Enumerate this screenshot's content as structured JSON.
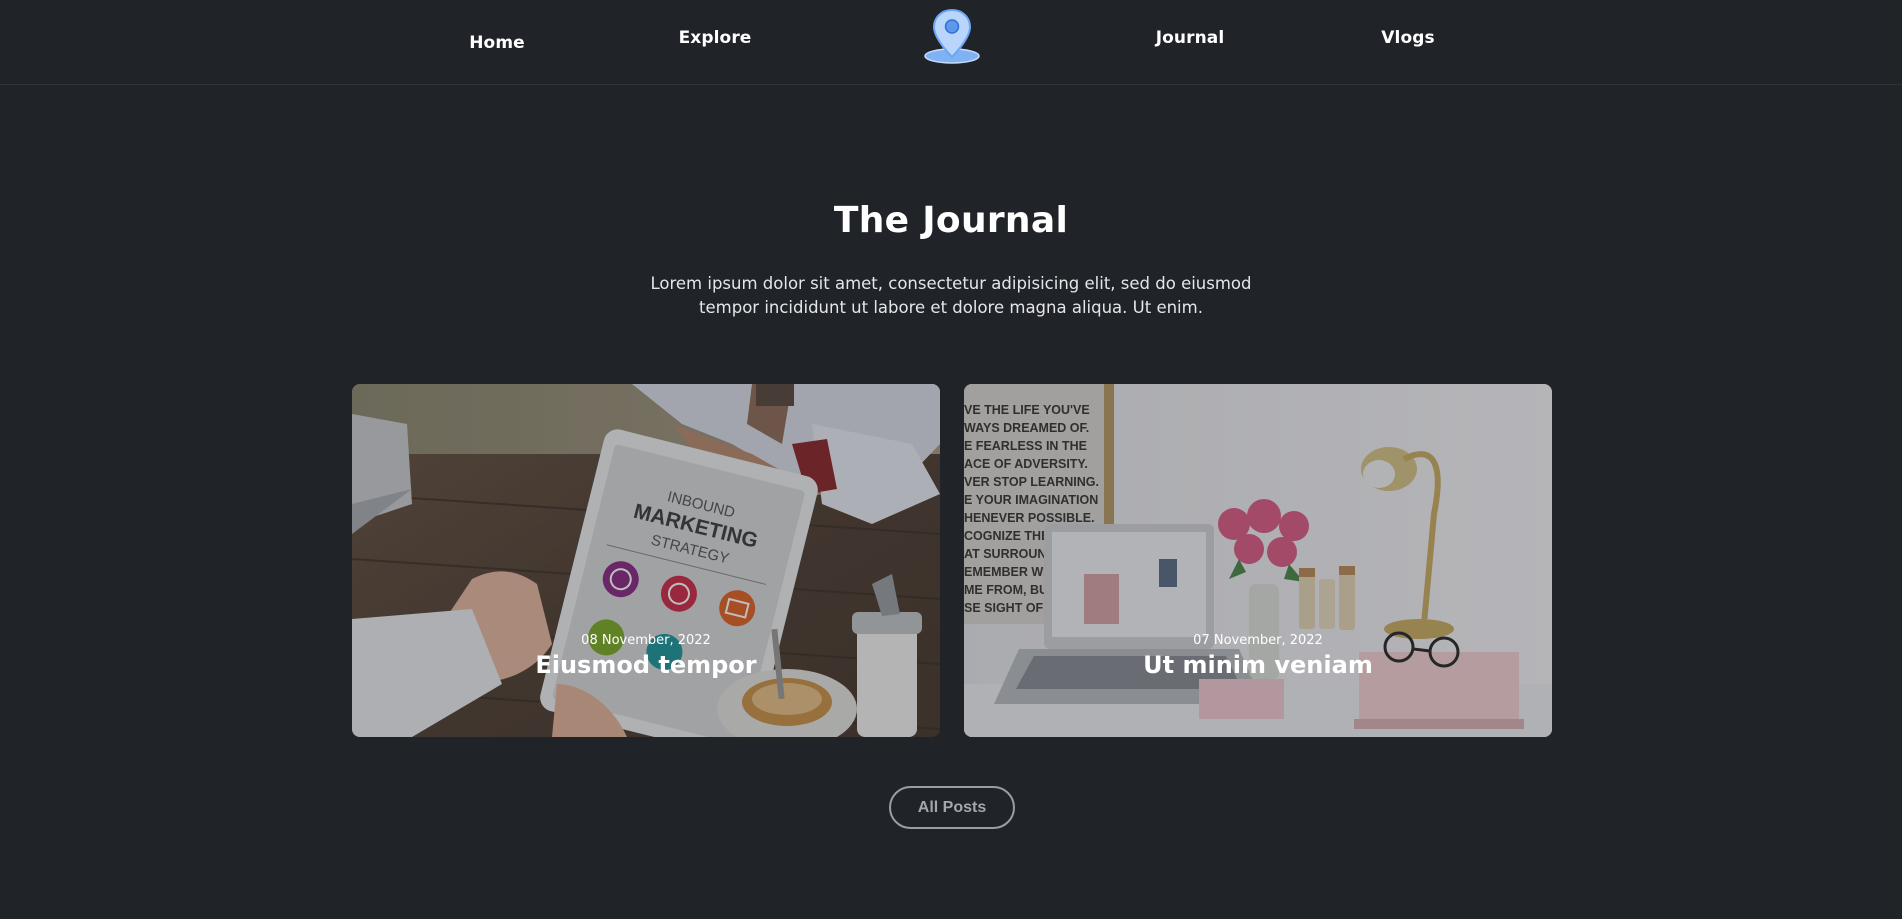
{
  "nav": {
    "home_label": "Home",
    "explore_label": "Explore",
    "logo_icon": "map-pin-icon",
    "journal_label": "Journal",
    "vlogs_label": "Vlogs"
  },
  "journal": {
    "title": "The Journal",
    "description": "Lorem ipsum dolor sit amet, consectetur adipisicing elit, sed do eiusmod tempor incididunt ut labore et dolore magna aliqua. Ut enim."
  },
  "posts": [
    {
      "date": "08 November, 2022",
      "title": "Eiusmod tempor",
      "image_subject": "tablet-marketing-photo"
    },
    {
      "date": "07 November, 2022",
      "title": "Ut minim veniam",
      "image_subject": "desk-laptop-flowers-photo"
    }
  ],
  "footer": {
    "all_posts_label": "All Posts"
  },
  "colors": {
    "background": "#202328",
    "text": "#ffffff",
    "button_border": "#9a9da2",
    "logo_blue": "#6aa8f8"
  }
}
